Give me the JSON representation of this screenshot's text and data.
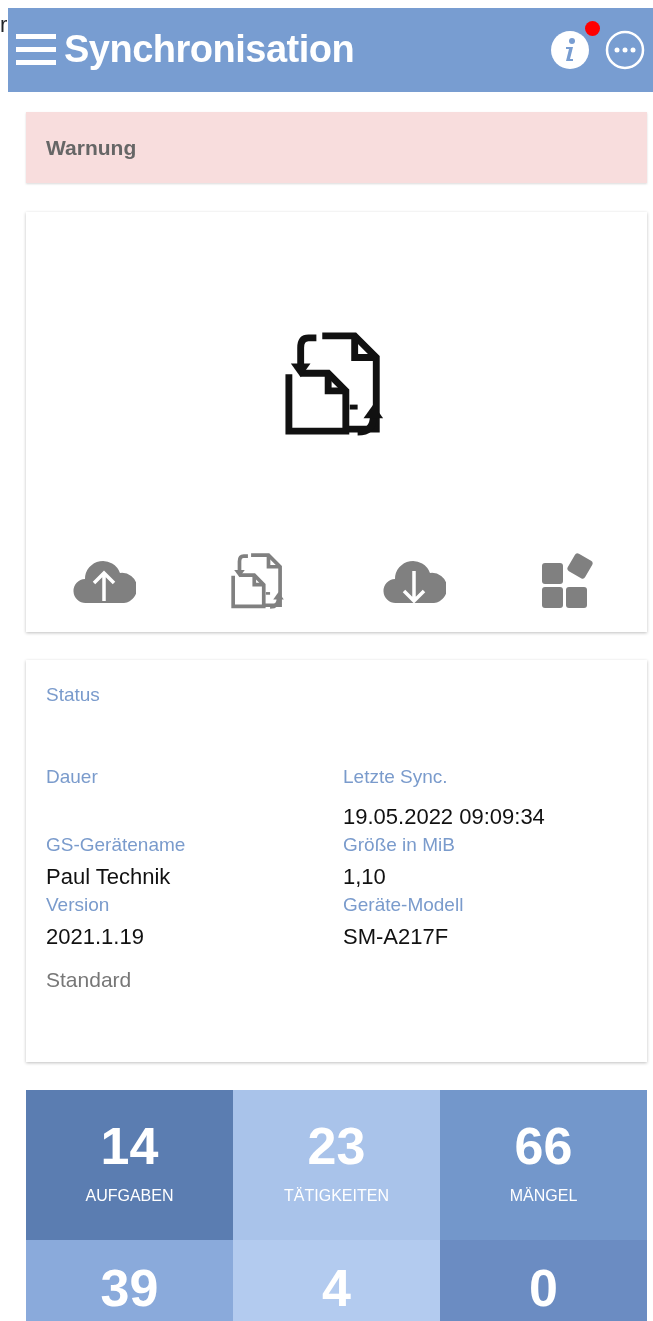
{
  "edge_fragment": "r",
  "app_bar": {
    "title": "Synchronisation",
    "info_badge": true
  },
  "warning": {
    "title": "Warnung"
  },
  "status_card": {
    "status_label": "Status",
    "fields": [
      {
        "label": "Dauer"
      },
      {
        "label": "Letzte Sync.",
        "value": "19.05.2022 09:09:34"
      },
      {
        "label": "GS-Gerätename",
        "value": "Paul Technik"
      },
      {
        "label": "Größe in MiB",
        "value": "1,10"
      },
      {
        "label": "Version",
        "value": "2021.1.19"
      },
      {
        "label": "Geräte-Modell",
        "value": "SM-A217F"
      }
    ],
    "mode": "Standard"
  },
  "tiles": [
    {
      "count": "14",
      "label": "AUFGABEN",
      "color": "#5b7db1"
    },
    {
      "count": "23",
      "label": "TÄTIGKEITEN",
      "color": "#a9c3ea"
    },
    {
      "count": "66",
      "label": "MÄNGEL",
      "color": "#7397cb"
    },
    {
      "count": "39",
      "color": "#8aaadb"
    },
    {
      "count": "4",
      "color": "#b3cbef"
    },
    {
      "count": "0",
      "color": "#6b8cc2"
    }
  ]
}
